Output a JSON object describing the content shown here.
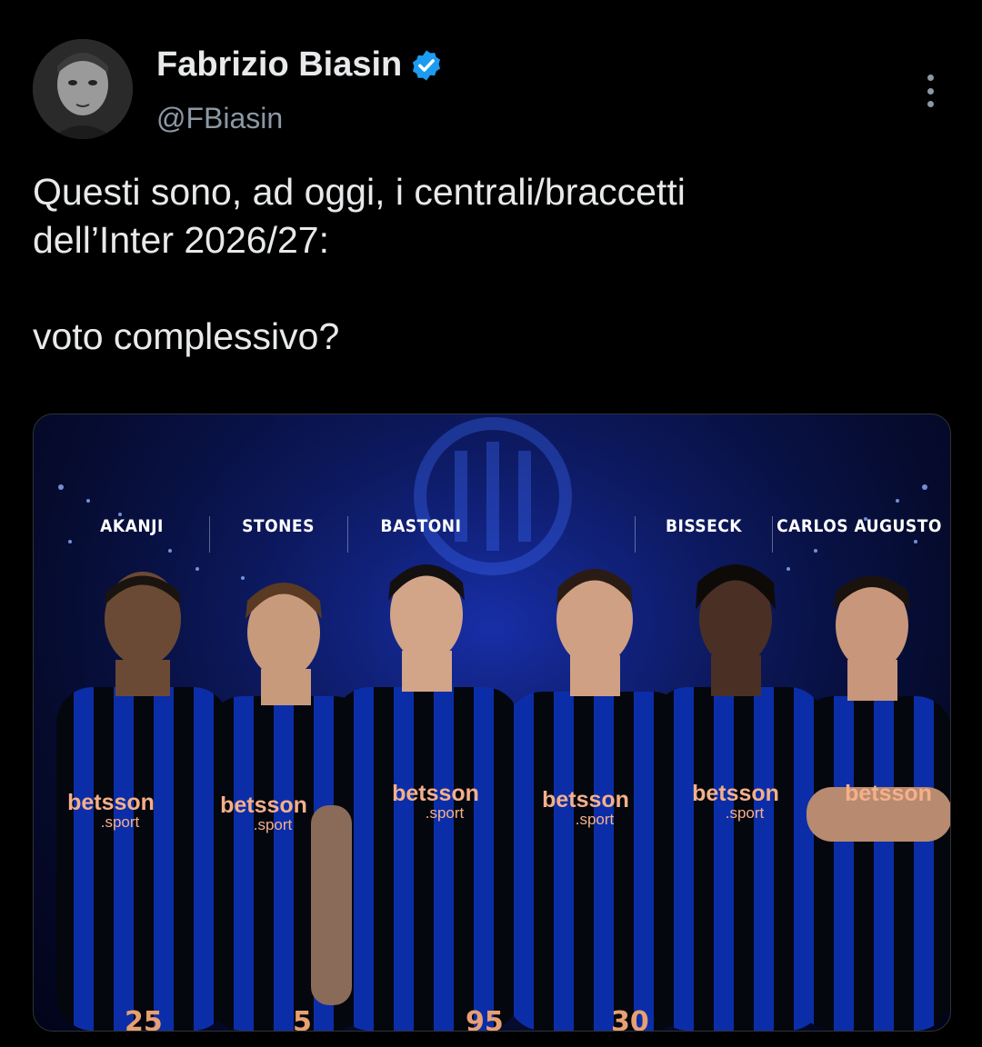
{
  "author": {
    "display_name": "Fabrizio Biasin",
    "handle": "@FBiasin",
    "avatar_icon": "person-portrait-grayscale",
    "verified_icon": "verified-badge-icon",
    "verified_color": "#1d9bf0"
  },
  "tweet": {
    "line1": "Questi sono, ad oggi, i centrali/braccetti",
    "line2": "dell’Inter 2026/27:",
    "line3": "voto complessivo?"
  },
  "media": {
    "players": [
      {
        "name": "AKANJI"
      },
      {
        "name": "STONES"
      },
      {
        "name": "BASTONI"
      },
      {
        "name": "BISSECK"
      },
      {
        "name": "CARLOS AUGUSTO"
      }
    ],
    "sponsor_main": "betsson",
    "sponsor_sub": ".sport",
    "background_color": "#0a1450",
    "kit_colors": [
      "#0a2fb0",
      "#000000"
    ]
  },
  "menu": {
    "icon": "more-vertical-icon"
  },
  "colors": {
    "background": "#000000",
    "text": "#e7e9ea",
    "secondary_text": "#8b98a5"
  }
}
